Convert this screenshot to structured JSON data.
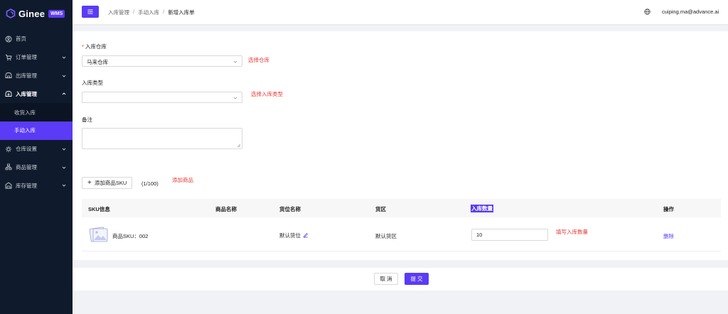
{
  "app": {
    "logo_text": "Ginee",
    "logo_badge": "WMS"
  },
  "sidebar": {
    "items": [
      {
        "label": "首页",
        "icon": "home-icon"
      },
      {
        "label": "订单管理",
        "icon": "cart-icon"
      },
      {
        "label": "出库管理",
        "icon": "outbound-icon"
      },
      {
        "label": "入库管理",
        "icon": "inbound-icon"
      },
      {
        "label": "仓库设置",
        "icon": "warehouse-icon"
      },
      {
        "label": "商品管理",
        "icon": "goods-icon"
      },
      {
        "label": "库存管理",
        "icon": "stock-icon"
      }
    ],
    "sub_items": [
      {
        "label": "收货入库"
      },
      {
        "label": "手动入库"
      }
    ]
  },
  "header": {
    "breadcrumb": [
      "入库管理",
      "手动入库",
      "新增入库单"
    ],
    "separator": "/",
    "user_email": "cuiping.ma@advance.ai"
  },
  "form": {
    "warehouse_label": "入库仓库",
    "required_mark": "*",
    "warehouse_value": "马来仓库",
    "warehouse_hint": "选择仓库",
    "type_label": "入库类型",
    "type_value": "",
    "type_hint": "选择入库类型",
    "remark_label": "备注",
    "add_button": "添加商品SKU",
    "add_plus": "+",
    "count": "(1/100)",
    "add_hint": "添加商品"
  },
  "table": {
    "columns": [
      "SKU信息",
      "商品名称",
      "货位名称",
      "货区",
      "入库数量",
      "操作"
    ],
    "rows": [
      {
        "sku": "商品SKU：002",
        "name": "",
        "location": "默认货位",
        "area": "默认货区",
        "qty": "10",
        "qty_hint": "填写入库数量",
        "action": "删除"
      }
    ]
  },
  "footer": {
    "cancel": "取 消",
    "submit": "提 交"
  },
  "colors": {
    "accent": "#5b3bf5",
    "hint": "#e53935",
    "sidebar": "#0f1b2d"
  }
}
